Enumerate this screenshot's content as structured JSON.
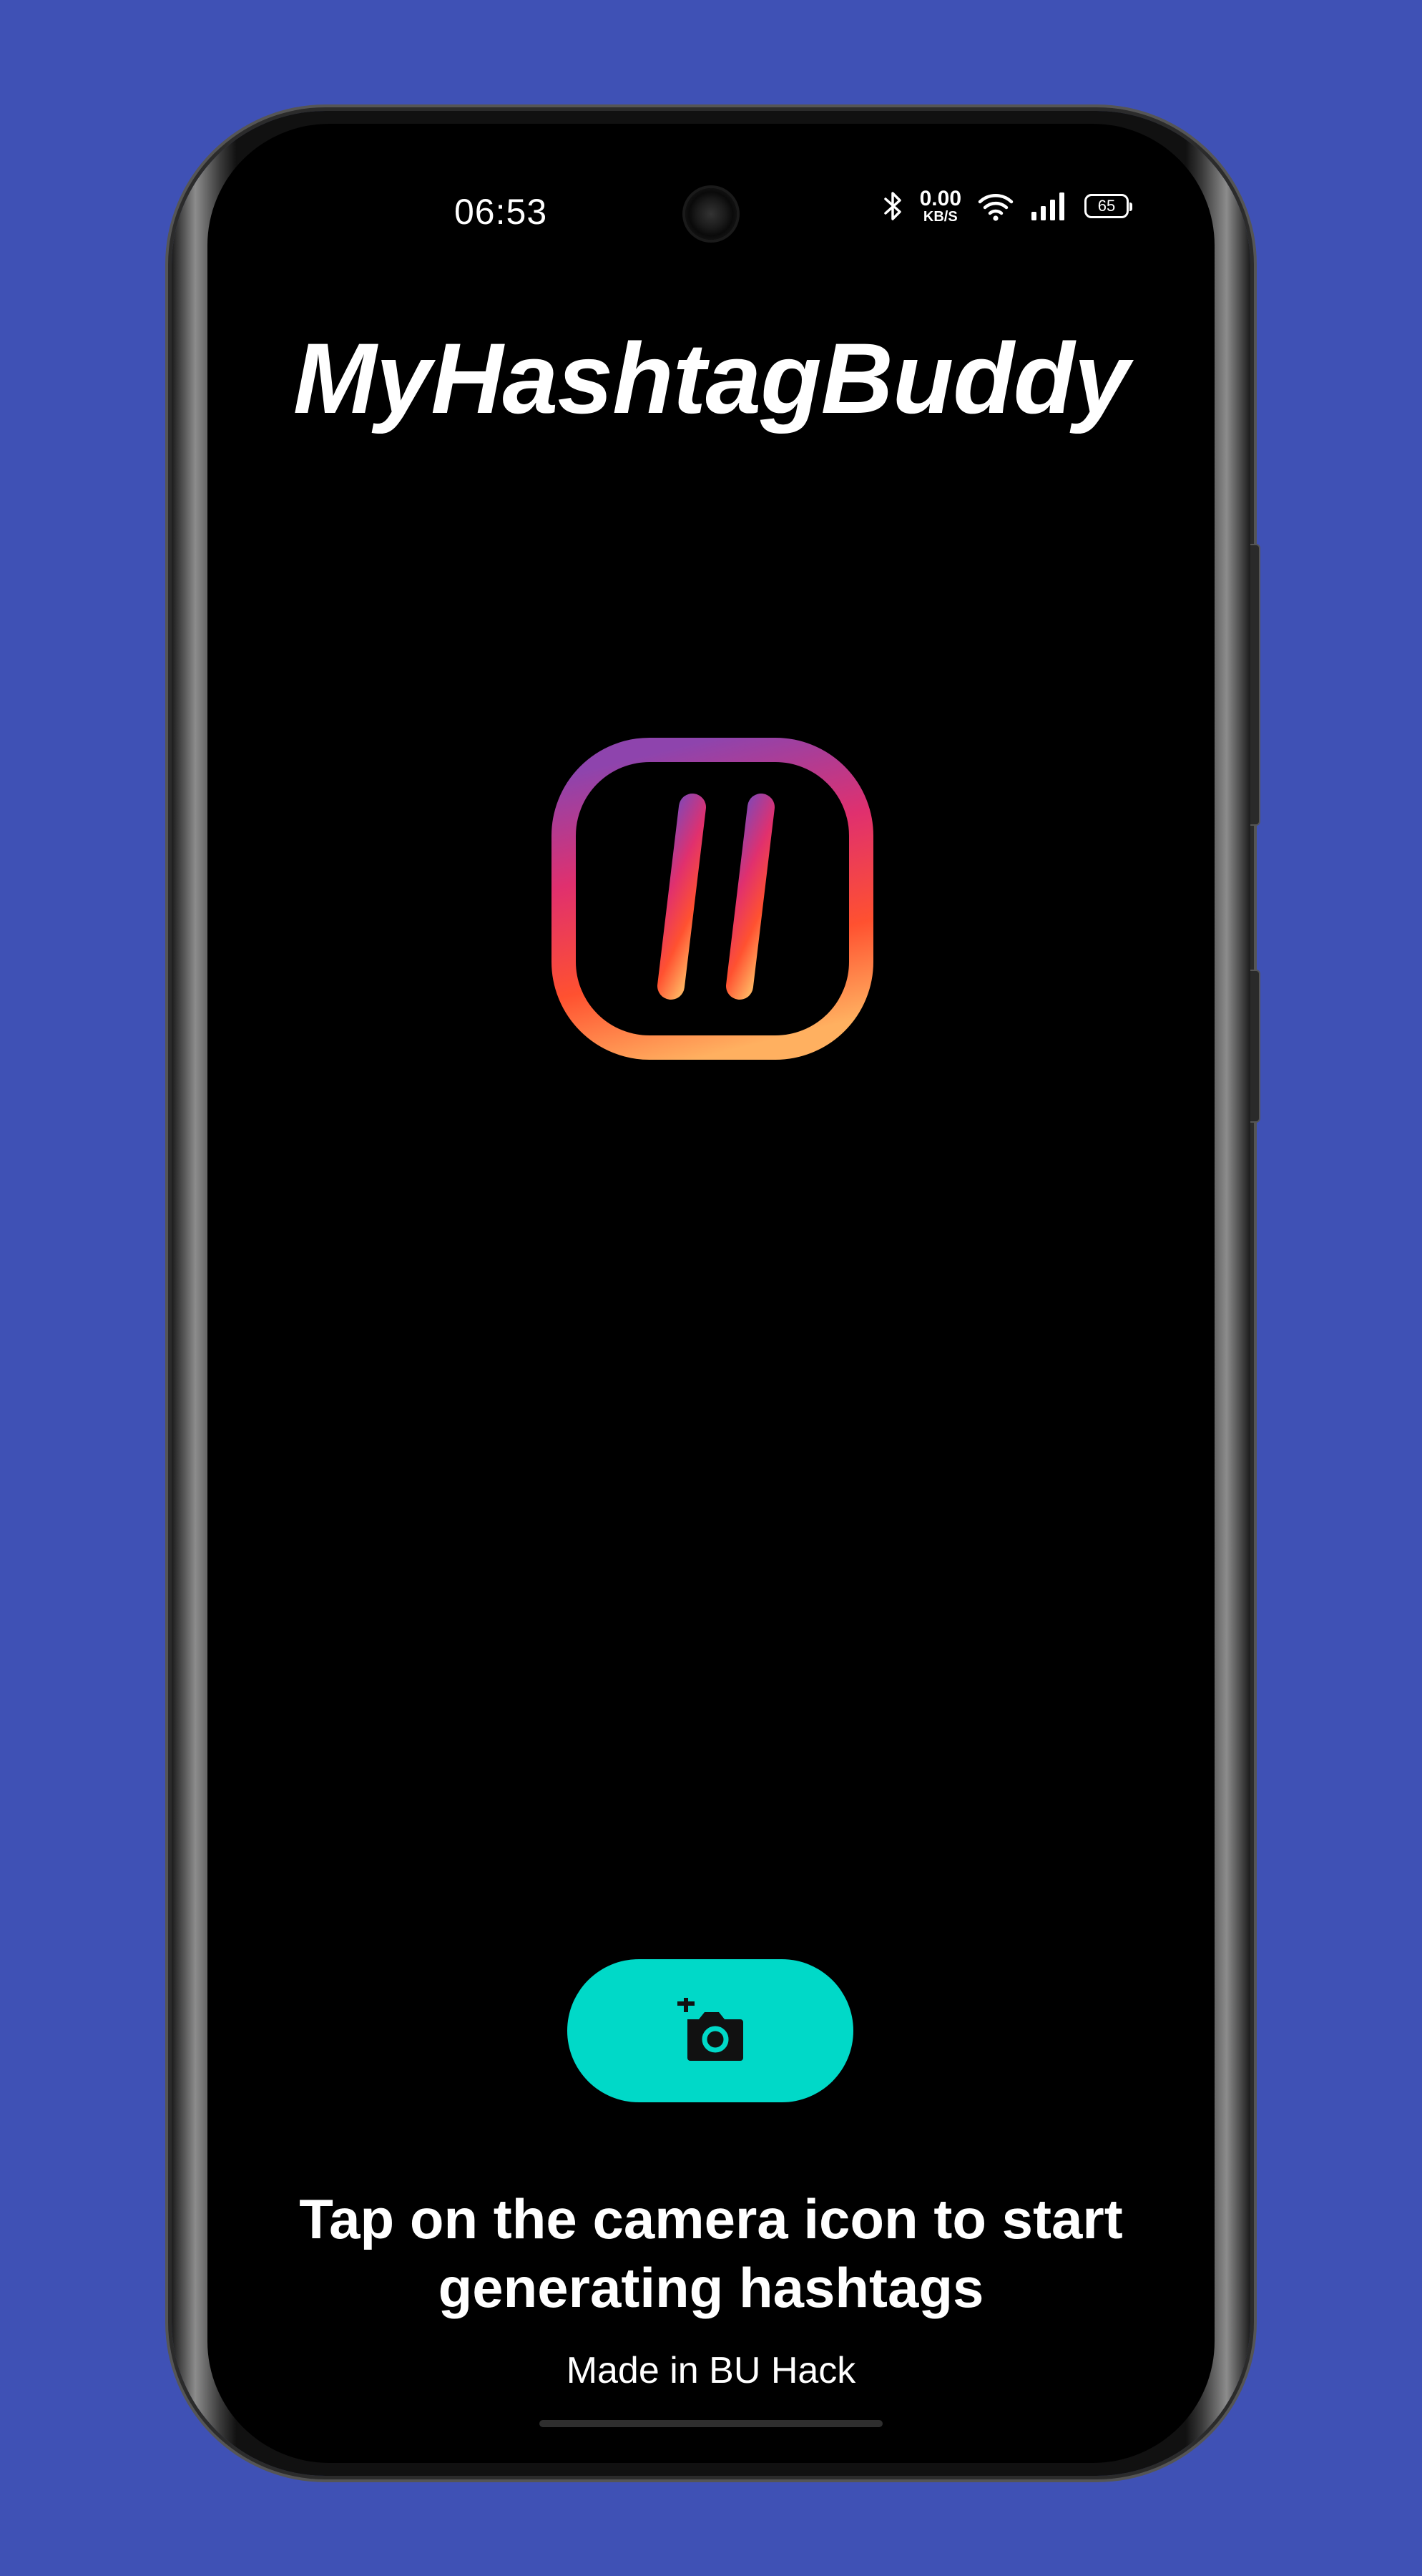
{
  "status_bar": {
    "time": "06:53",
    "network_speed": "0.00",
    "network_unit": "KB/S",
    "battery_level": "65"
  },
  "app": {
    "title": "MyHashtagBuddy",
    "logo_icon": "hashtag-icon"
  },
  "actions": {
    "camera_button_icon": "add-photo-camera-icon",
    "accent_color": "#00d9c8"
  },
  "main": {
    "instruction_line1": "Tap on the camera icon to start",
    "instruction_line2": "generating hashtags",
    "footer": "Made in BU Hack"
  },
  "colors": {
    "background": "#3f51b5",
    "screen": "#000000",
    "logo_gradient": [
      "#8e44ad",
      "#e91e63",
      "#ff5722",
      "#ffb060"
    ]
  }
}
